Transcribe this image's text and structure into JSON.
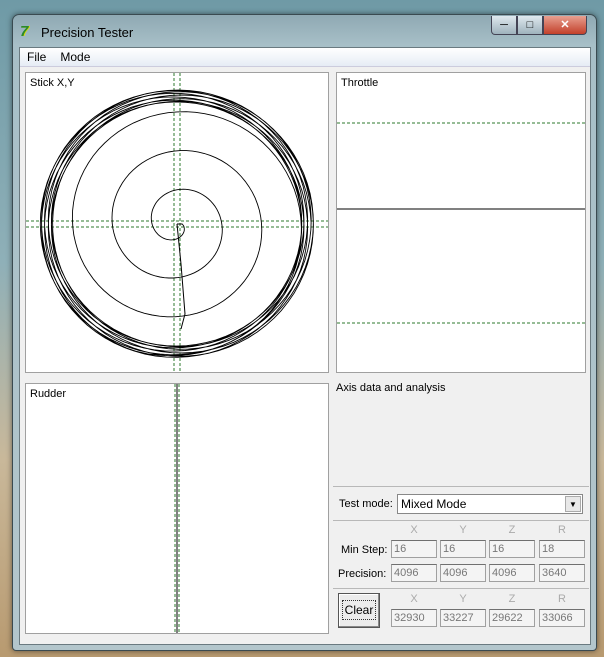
{
  "window": {
    "title": "Precision Tester",
    "app_icon": "app-logo-icon",
    "controls": [
      "minimize",
      "maximize",
      "close"
    ]
  },
  "menu": [
    "File",
    "Mode"
  ],
  "panels": {
    "stick": "Stick X,Y",
    "throttle": "Throttle",
    "rudder": "Rudder",
    "analysis": "Axis data and analysis"
  },
  "test_mode": {
    "label": "Test mode:",
    "value": "Mixed Mode"
  },
  "columns": [
    "X",
    "Y",
    "Z",
    "R"
  ],
  "min_step": {
    "label": "Min Step:",
    "values": [
      "16",
      "16",
      "16",
      "18"
    ]
  },
  "precision": {
    "label": "Precision:",
    "values": [
      "4096",
      "4096",
      "4096",
      "3640"
    ]
  },
  "clear_label": "Clear",
  "current": {
    "values": [
      "32930",
      "33227",
      "29622",
      "33066"
    ]
  },
  "colors": {
    "guide": "#2e7a2e",
    "trace": "#000000"
  }
}
